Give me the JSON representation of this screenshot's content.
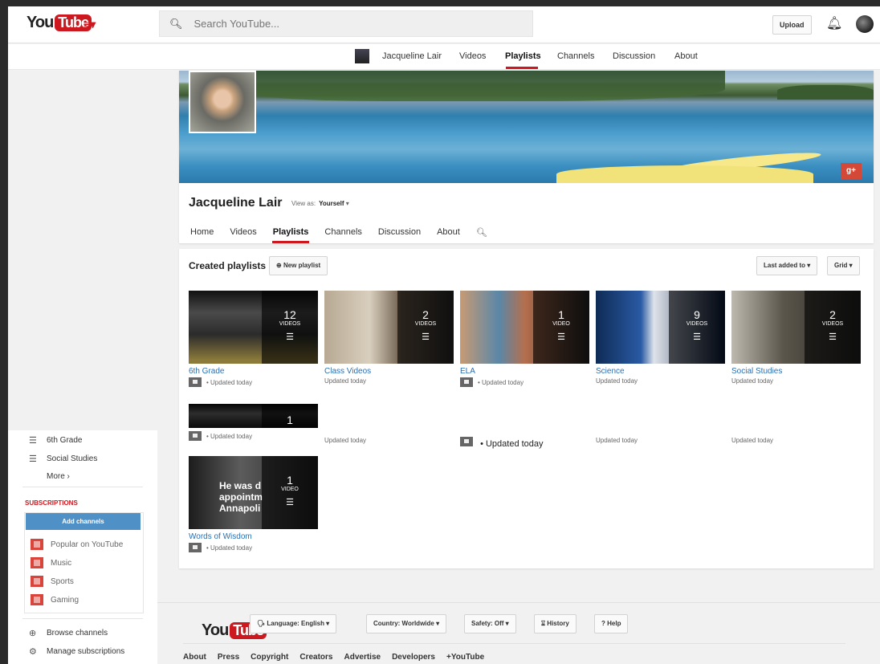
{
  "masthead": {
    "logo_you": "You",
    "logo_tube": "Tube",
    "guide_icon": "menu-icon",
    "search_placeholder": "Search YouTube...",
    "upload_label": "Upload"
  },
  "subnav": {
    "channel_name": "Jacqueline Lair",
    "items": [
      "Videos",
      "Playlists",
      "Channels",
      "Discussion",
      "About"
    ],
    "active": "Playlists"
  },
  "channel": {
    "name": "Jacqueline Lair",
    "view_as_label": "View as:",
    "view_as_value": "Yourself",
    "tabs": [
      "Home",
      "Videos",
      "Playlists",
      "Channels",
      "Discussion",
      "About"
    ],
    "active_tab": "Playlists"
  },
  "playlists_section": {
    "title": "Created playlists",
    "new_playlist": "New playlist",
    "sort": "Last added to",
    "view": "Grid"
  },
  "playlists": [
    {
      "name": "6th Grade",
      "count": "12",
      "label": "VIDEOS",
      "meta": "• Updated today",
      "locked": true
    },
    {
      "name": "Class Videos",
      "count": "2",
      "label": "VIDEOS",
      "meta": "Updated today",
      "locked": false
    },
    {
      "name": "ELA",
      "count": "1",
      "label": "VIDEO",
      "meta": "• Updated today",
      "locked": true
    },
    {
      "name": "Science",
      "count": "9",
      "label": "VIDEOS",
      "meta": "Updated today",
      "locked": false
    },
    {
      "name": "Social Studies",
      "count": "2",
      "label": "VIDEOS",
      "meta": "Updated today",
      "locked": false
    }
  ],
  "row2": {
    "partial_count": "1",
    "metas": [
      "• Updated today",
      "Updated today",
      "• Updated today",
      "Updated today",
      "Updated today"
    ]
  },
  "row3": {
    "name": "Words of Wisdom",
    "count": "1",
    "label": "VIDEO",
    "meta": "• Updated today",
    "quote": "He was d\nappointm\nAnnapoli"
  },
  "guide": {
    "items": [
      "6th Grade",
      "Social Studies"
    ],
    "more": "More ›",
    "subscriptions_header": "SUBSCRIPTIONS",
    "add_channels": "Add channels",
    "subscriptions": [
      "Popular on YouTube",
      "Music",
      "Sports",
      "Gaming"
    ],
    "browse_channels": "Browse channels",
    "manage_subscriptions": "Manage subscriptions"
  },
  "footer": {
    "language": "Language: English",
    "country": "Country: Worldwide",
    "safety": "Safety: Off",
    "history": "History",
    "help": "Help",
    "links": [
      "About",
      "Press",
      "Copyright",
      "Creators",
      "Advertise",
      "Developers",
      "+YouTube"
    ]
  },
  "colors": {
    "accent": "#cc181e",
    "link": "#2a6fb2",
    "add_channels_bg": "#4f91c6"
  }
}
